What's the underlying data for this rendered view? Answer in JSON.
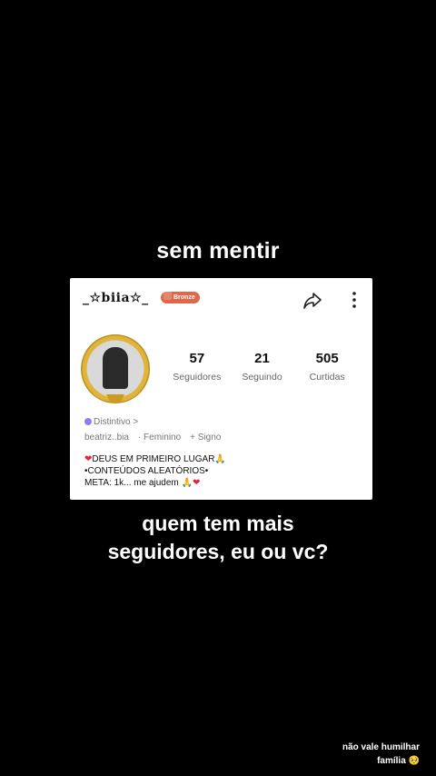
{
  "overlay": {
    "top_text": "sem mentir",
    "bottom_line1": "quem tem mais",
    "bottom_line2": "seguidores, eu ou vc?",
    "corner_line1": "não vale humilhar",
    "corner_line2": "família 🥺"
  },
  "profile": {
    "username": "_☆biia☆_",
    "badge_label": "Bronze",
    "stats": [
      {
        "value": "57",
        "label": "Seguidores"
      },
      {
        "value": "21",
        "label": "Seguindo"
      },
      {
        "value": "505",
        "label": "Curtidas"
      }
    ],
    "distintivo": "Distintivo >",
    "meta": [
      "beatriz..bia",
      "· Feminino",
      "+ Signo"
    ],
    "bio": {
      "line1": "DEUS EM PRIMEIRO LUGAR🙏",
      "line2": "•CONTEÚDOS  ALEATÓRIOS•",
      "line3": "META: 1k... me ajudem 🙏"
    }
  },
  "colors": {
    "accent_badge": "#e0674a",
    "heart": "#e0243b",
    "frame_gold": "#e0b43a"
  },
  "icons": [
    "share-icon",
    "more-vertical-icon",
    "heart-icon",
    "distintivo-icon"
  ]
}
